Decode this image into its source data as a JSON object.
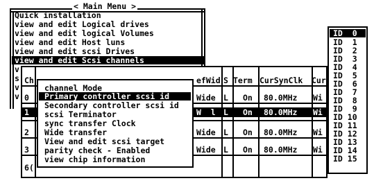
{
  "main_menu": {
    "title": "< Main Menu >",
    "items": [
      {
        "label": "Quick installation"
      },
      {
        "label": "view and edit Logical drives"
      },
      {
        "label": "view and edit logical Volumes"
      },
      {
        "label": "view and edit Host luns"
      },
      {
        "label": "view and edit scsi Drives"
      },
      {
        "label": "view and edit Scsi channels",
        "selected": true
      },
      {
        "label": "v"
      },
      {
        "label": "s"
      },
      {
        "label": "v"
      },
      {
        "label": "v"
      }
    ]
  },
  "channel_table": {
    "headers": {
      "ch": "Ch",
      "defid": "efWid",
      "s": "S",
      "term": "Term",
      "cursync": "CurSynClk",
      "cur": "Cur"
    },
    "rows": [
      {
        "ch": "0",
        "defid": "Wide",
        "s": "L",
        "term": "On",
        "cursync": "80.0MHz",
        "cur": "Wi",
        "selected": false
      },
      {
        "ch": "1",
        "defid": "W  l",
        "s": "L",
        "term": "On",
        "cursync": "80.0MHz",
        "cur": "Wi",
        "selected": true
      },
      {
        "ch": "2",
        "defid": "Wide",
        "s": "L",
        "term": "On",
        "cursync": "80.0MHz",
        "cur": "Wi",
        "selected": false
      },
      {
        "ch": "3",
        "defid": "Wide",
        "s": "L",
        "term": "On",
        "cursync": "80.0MHz",
        "cur": "Wi",
        "selected": false
      },
      {
        "ch": "6(",
        "defid": "",
        "s": "",
        "term": "",
        "cursync": "",
        "cur": "",
        "selected": false
      }
    ]
  },
  "channel_submenu": {
    "items": [
      {
        "label": "channel Mode"
      },
      {
        "label": "Primary controller scsi id",
        "selected": true
      },
      {
        "label": "Secondary controller scsi id"
      },
      {
        "label": "scsi Terminator"
      },
      {
        "label": "sync transfer Clock"
      },
      {
        "label": "Wide transfer"
      },
      {
        "label": "View and edit scsi target"
      },
      {
        "label": "parity check - Enabled"
      },
      {
        "label": "view chip information"
      }
    ]
  },
  "id_list": {
    "items": [
      {
        "label": "ID  0",
        "selected": true
      },
      {
        "label": "ID  1"
      },
      {
        "label": "ID  2"
      },
      {
        "label": "ID  3"
      },
      {
        "label": "ID  4"
      },
      {
        "label": "ID  5"
      },
      {
        "label": "ID  6"
      },
      {
        "label": "ID  7"
      },
      {
        "label": "ID  8"
      },
      {
        "label": "ID  9"
      },
      {
        "label": "ID 10"
      },
      {
        "label": "ID 11"
      },
      {
        "label": "ID 12"
      },
      {
        "label": "ID 13"
      },
      {
        "label": "ID 14"
      },
      {
        "label": "ID 15"
      }
    ]
  }
}
